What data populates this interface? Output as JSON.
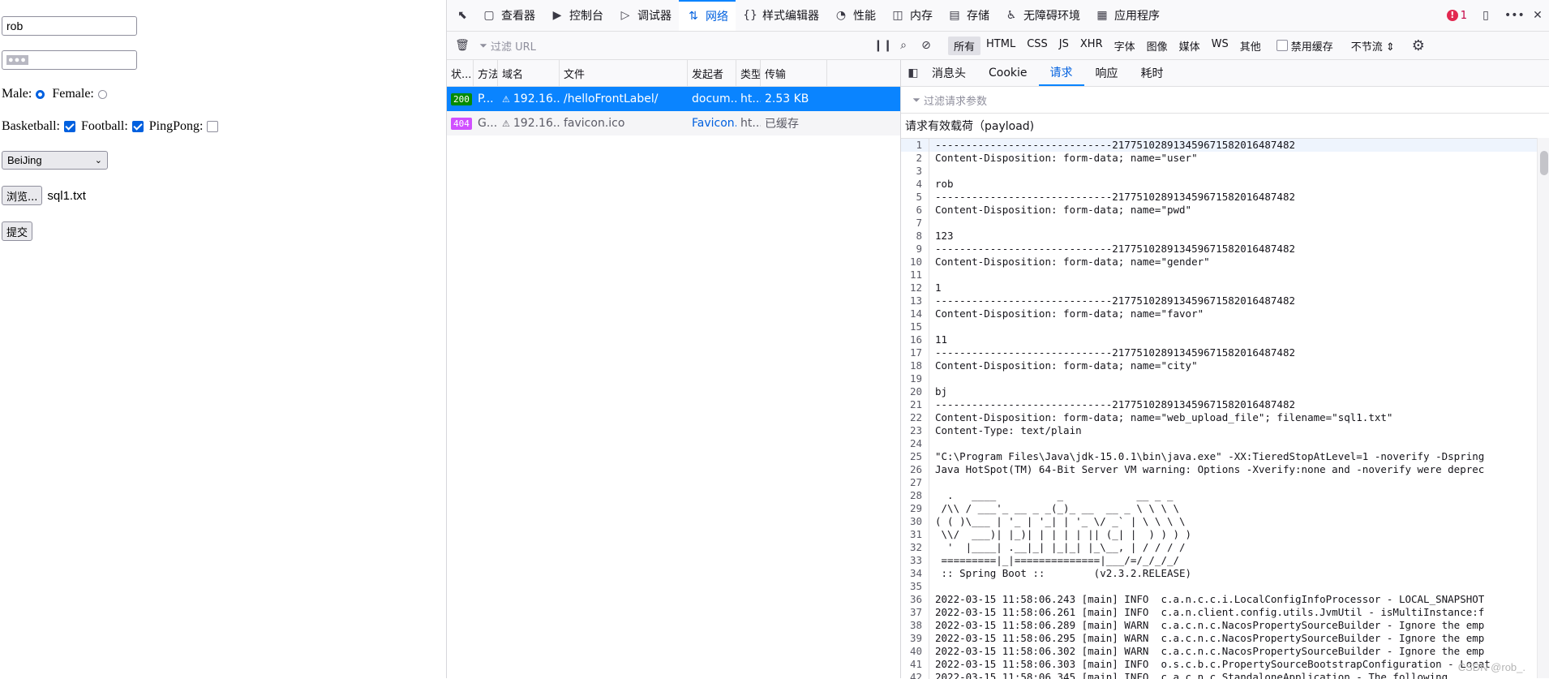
{
  "form": {
    "username": "rob",
    "password_mask": "●●●",
    "gender": {
      "male_label": "Male:",
      "female_label": "Female:",
      "selected": "male"
    },
    "favors": [
      {
        "label": "Basketball:",
        "checked": true
      },
      {
        "label": "Football:",
        "checked": true
      },
      {
        "label": "PingPong:",
        "checked": false
      }
    ],
    "city": "BeiJing",
    "browse_label": "浏览...",
    "file_name": "sql1.txt",
    "submit_label": "提交"
  },
  "devtools": {
    "tabs": [
      {
        "icon": "▢",
        "label": "查看器",
        "icon_name": "inspector-icon"
      },
      {
        "icon": "▶",
        "label": "控制台",
        "icon_name": "console-icon"
      },
      {
        "icon": "▷",
        "label": "调试器",
        "icon_name": "debugger-icon"
      },
      {
        "icon": "⇅",
        "label": "网络",
        "icon_name": "network-icon",
        "active": true
      },
      {
        "icon": "{}",
        "label": "样式编辑器",
        "icon_name": "style-editor-icon"
      },
      {
        "icon": "◔",
        "label": "性能",
        "icon_name": "performance-icon"
      },
      {
        "icon": "◫",
        "label": "内存",
        "icon_name": "memory-icon"
      },
      {
        "icon": "▤",
        "label": "存储",
        "icon_name": "storage-icon"
      },
      {
        "icon": "♿",
        "label": "无障碍环境",
        "icon_name": "accessibility-icon"
      },
      {
        "icon": "▦",
        "label": "应用程序",
        "icon_name": "application-icon"
      }
    ],
    "error_count": "1",
    "toolbar": {
      "filter_placeholder": "过滤 URL",
      "types": [
        "所有",
        "HTML",
        "CSS",
        "JS",
        "XHR",
        "字体",
        "图像",
        "媒体",
        "WS",
        "其他"
      ],
      "disable_cache": "禁用缓存",
      "throttle": "不节流 ⇕"
    },
    "columns": [
      "状...",
      "方法",
      "域名",
      "文件",
      "发起者",
      "类型",
      "传输"
    ],
    "requests": [
      {
        "status": "200",
        "method": "P...",
        "domain": "192.16...",
        "file": "/helloFrontLabel/",
        "initiator": "docum...",
        "type": "ht...",
        "transfer": "2.53 KB",
        "selected": true
      },
      {
        "status": "404",
        "method": "G...",
        "domain": "192.16...",
        "file": "favicon.ico",
        "initiator": "Favicon...",
        "type": "ht...",
        "transfer": "已缓存",
        "selected": false
      }
    ],
    "detail_tabs": [
      "消息头",
      "Cookie",
      "请求",
      "响应",
      "耗时"
    ],
    "active_detail_tab": "请求",
    "param_filter_placeholder": "过滤请求参数",
    "payload_title": "请求有效载荷（payload)",
    "payload_lines": [
      "-----------------------------217751028913459671582016487482",
      "Content-Disposition: form-data; name=\"user\"",
      "",
      "rob",
      "-----------------------------217751028913459671582016487482",
      "Content-Disposition: form-data; name=\"pwd\"",
      "",
      "123",
      "-----------------------------217751028913459671582016487482",
      "Content-Disposition: form-data; name=\"gender\"",
      "",
      "1",
      "-----------------------------217751028913459671582016487482",
      "Content-Disposition: form-data; name=\"favor\"",
      "",
      "11",
      "-----------------------------217751028913459671582016487482",
      "Content-Disposition: form-data; name=\"city\"",
      "",
      "bj",
      "-----------------------------217751028913459671582016487482",
      "Content-Disposition: form-data; name=\"web_upload_file\"; filename=\"sql1.txt\"",
      "Content-Type: text/plain",
      "",
      "\"C:\\Program Files\\Java\\jdk-15.0.1\\bin\\java.exe\" -XX:TieredStopAtLevel=1 -noverify -Dspring",
      "Java HotSpot(TM) 64-Bit Server VM warning: Options -Xverify:none and -noverify were deprec",
      "",
      "  .   ____          _            __ _ _",
      " /\\\\ / ___'_ __ _ _(_)_ __  __ _ \\ \\ \\ \\",
      "( ( )\\___ | '_ | '_| | '_ \\/ _` | \\ \\ \\ \\",
      " \\\\/  ___)| |_)| | | | | || (_| |  ) ) ) )",
      "  '  |____| .__|_| |_|_| |_\\__, | / / / /",
      " =========|_|==============|___/=/_/_/_/",
      " :: Spring Boot ::        (v2.3.2.RELEASE)",
      "",
      "2022-03-15 11:58:06.243 [main] INFO  c.a.n.c.c.i.LocalConfigInfoProcessor - LOCAL_SNAPSHOT",
      "2022-03-15 11:58:06.261 [main] INFO  c.a.n.client.config.utils.JvmUtil - isMultiInstance:f",
      "2022-03-15 11:58:06.289 [main] WARN  c.a.c.n.c.NacosPropertySourceBuilder - Ignore the emp",
      "2022-03-15 11:58:06.295 [main] WARN  c.a.c.n.c.NacosPropertySourceBuilder - Ignore the emp",
      "2022-03-15 11:58:06.302 [main] WARN  c.a.c.n.c.NacosPropertySourceBuilder - Ignore the emp",
      "2022-03-15 11:58:06.303 [main] INFO  o.s.c.b.c.PropertySourceBootstrapConfiguration - Locat",
      "2022-03-15 11:58:06.345 [main] INFO  c.a.c.n.c.StandaloneApplication - The following"
    ],
    "watermark": "CSDN @rob_."
  }
}
